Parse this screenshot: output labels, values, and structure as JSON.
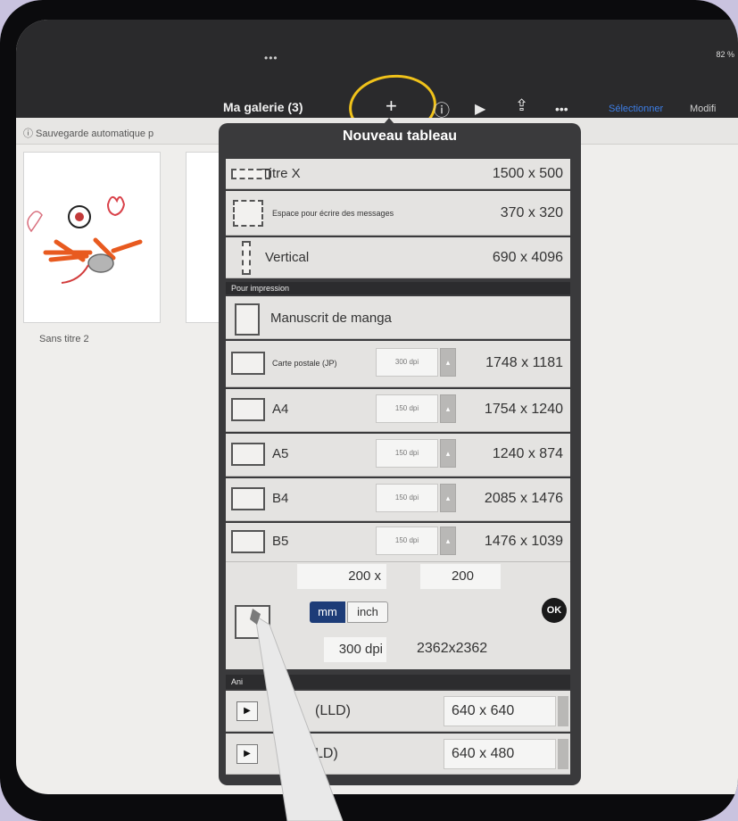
{
  "toolbar": {
    "more_dots_top": "•••",
    "status_right": "82 %",
    "gallery_title": "Ma galerie (3)",
    "add_icon": "+",
    "info_icon": "ⓘ",
    "play_icon": "▶",
    "share_icon": "⇪",
    "more_icon": "•••",
    "select_label": "Sélectionner",
    "modify_label": "Modifi"
  },
  "infobar": {
    "text": "ⓘ Sauvegarde automatique p"
  },
  "gallery": {
    "thumb_label": "Sans titre 2"
  },
  "popover": {
    "title": "Nouveau tableau",
    "presets": [
      {
        "label": "Titre X",
        "size": "1500 x 500"
      },
      {
        "label": "Espace pour écrire des messages",
        "size": "370 x 320"
      },
      {
        "label": "Vertical",
        "size": "690 x 4096"
      }
    ],
    "print_section": "Pour impression",
    "print_items": [
      {
        "label": "Manuscrit de manga",
        "dpi": "",
        "size": ""
      },
      {
        "label": "Carte postale (JP)",
        "dpi": "300 dpi",
        "size": "1748 x 1181"
      },
      {
        "label": "A4",
        "dpi": "150 dpi",
        "size": "1754 x 1240"
      },
      {
        "label": "A5",
        "dpi": "150 dpi",
        "size": "1240 x 874"
      },
      {
        "label": "B4",
        "dpi": "150 dpi",
        "size": "2085 x 1476"
      },
      {
        "label": "B5",
        "dpi": "150 dpi",
        "size": "1476 x 1039"
      }
    ],
    "custom": {
      "width": "200 x",
      "height": "200",
      "unit_mm": "mm",
      "unit_inch": "inch",
      "ok": "OK",
      "dpi": "300 dpi",
      "pixels": "2362x2362"
    },
    "anim_section": "Ani",
    "anim_items": [
      {
        "label": "(LLD)",
        "size": "640 x 640"
      },
      {
        "label": "LD)",
        "size": "640 x 480"
      }
    ]
  },
  "colors": {
    "accent_blue": "#3d7ee6",
    "unit_selected": "#1d3c78",
    "highlight_ring": "#f0c21a"
  }
}
